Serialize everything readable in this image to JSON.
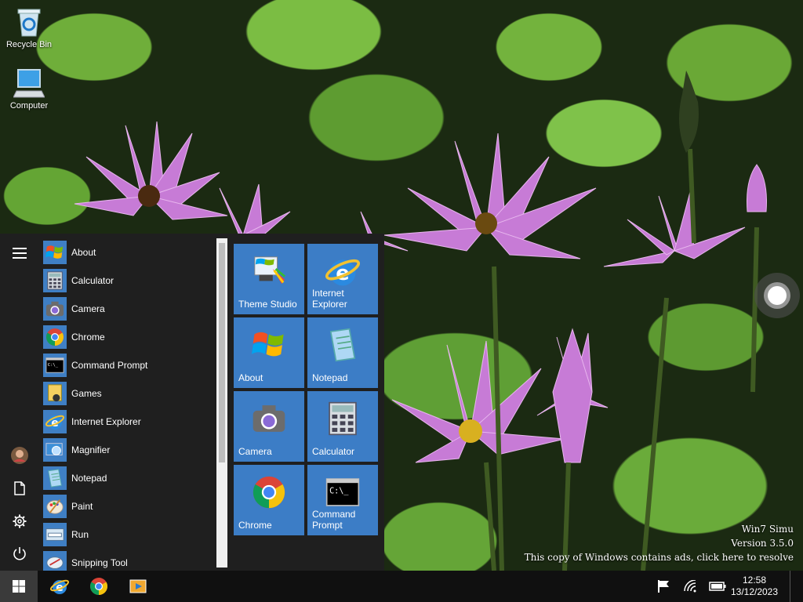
{
  "desktop": {
    "icons": [
      {
        "label": "Recycle Bin",
        "icon": "recycle-bin-icon"
      },
      {
        "label": "Computer",
        "icon": "computer-icon"
      }
    ],
    "watermark": {
      "line1": "Win7 Simu",
      "line2": "Version 3.5.0",
      "line3": "This copy of Windows contains ads, click here to resolve"
    }
  },
  "start_menu": {
    "rail": [
      {
        "icon": "hamburger-menu-icon"
      },
      {
        "icon": "user-avatar-icon"
      },
      {
        "icon": "document-icon"
      },
      {
        "icon": "gear-icon"
      },
      {
        "icon": "power-icon"
      }
    ],
    "apps": [
      {
        "label": "About",
        "icon": "windows-flag-icon"
      },
      {
        "label": "Calculator",
        "icon": "calculator-icon"
      },
      {
        "label": "Camera",
        "icon": "camera-icon"
      },
      {
        "label": "Chrome",
        "icon": "chrome-icon"
      },
      {
        "label": "Command Prompt",
        "icon": "command-prompt-icon"
      },
      {
        "label": "Games",
        "icon": "games-icon"
      },
      {
        "label": "Internet Explorer",
        "icon": "internet-explorer-icon"
      },
      {
        "label": "Magnifier",
        "icon": "magnifier-icon"
      },
      {
        "label": "Notepad",
        "icon": "notepad-icon"
      },
      {
        "label": "Paint",
        "icon": "paint-icon"
      },
      {
        "label": "Run",
        "icon": "run-icon"
      },
      {
        "label": "Snipping Tool",
        "icon": "snipping-tool-icon"
      }
    ],
    "tiles": [
      {
        "label": "Theme Studio",
        "icon": "theme-studio-icon"
      },
      {
        "label": "Internet Explorer",
        "icon": "internet-explorer-icon"
      },
      {
        "label": "About",
        "icon": "windows-flag-icon"
      },
      {
        "label": "Notepad",
        "icon": "notepad-icon"
      },
      {
        "label": "Camera",
        "icon": "camera-icon"
      },
      {
        "label": "Calculator",
        "icon": "calculator-icon"
      },
      {
        "label": "Chrome",
        "icon": "chrome-icon"
      },
      {
        "label": "Command Prompt",
        "icon": "command-prompt-icon"
      }
    ]
  },
  "taskbar": {
    "start_icon": "windows-logo-icon",
    "pinned": [
      {
        "icon": "internet-explorer-icon"
      },
      {
        "icon": "chrome-icon"
      },
      {
        "icon": "media-player-icon"
      }
    ],
    "tray": [
      {
        "icon": "flag-icon"
      },
      {
        "icon": "wifi-icon"
      },
      {
        "icon": "battery-icon"
      }
    ],
    "clock": {
      "time": "12:58",
      "date": "13/12/2023"
    }
  },
  "colors": {
    "tile": "#3c7dc6",
    "start_bg": "#1f1f1f",
    "taskbar_bg": "#101010"
  }
}
